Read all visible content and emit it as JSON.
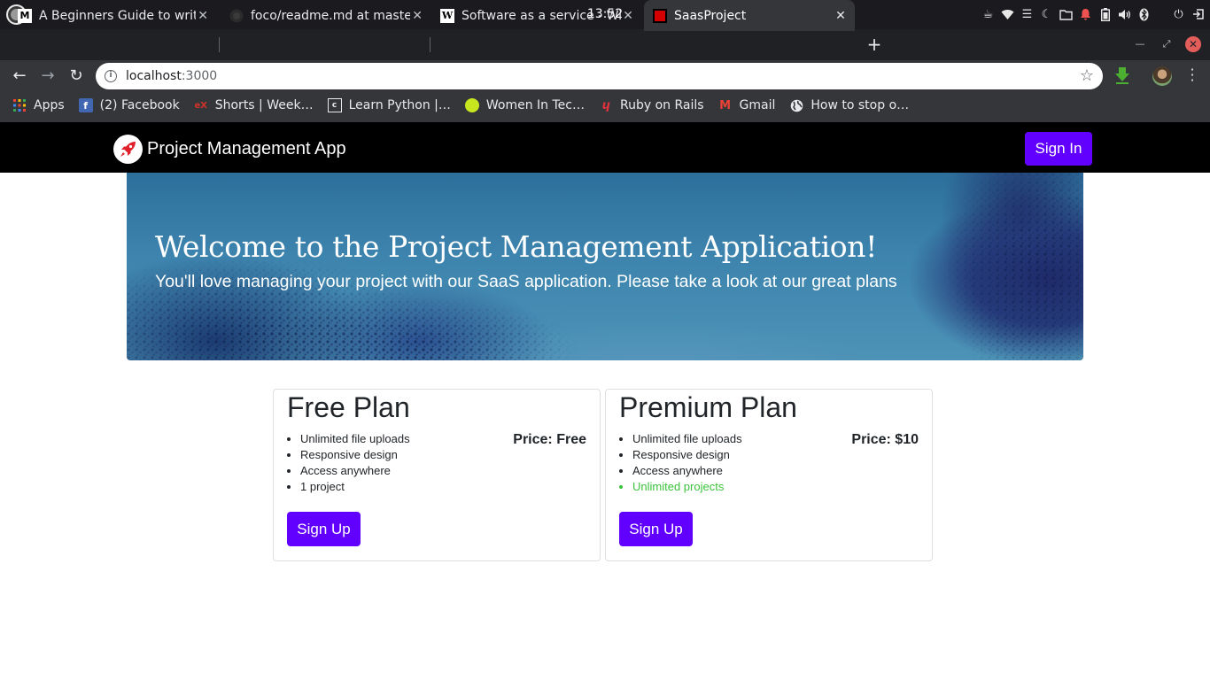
{
  "os": {
    "clock": "13:52",
    "tray_icons": [
      "coffee-icon",
      "wifi-icon",
      "menu-icon",
      "night-mode-icon",
      "folder-icon",
      "notification-icon",
      "battery-icon",
      "volume-icon",
      "bluetooth-icon",
      "power-icon",
      "logout-icon"
    ]
  },
  "tabs": [
    {
      "title": "A Beginners Guide to writ",
      "favicon": "medium-icon",
      "active": false
    },
    {
      "title": "foco/readme.md at maste",
      "favicon": "github-icon",
      "active": false
    },
    {
      "title": "Software as a service - Wi",
      "favicon": "wikipedia-icon",
      "active": false
    },
    {
      "title": "SaasProject",
      "favicon": "saas-icon",
      "active": true
    }
  ],
  "toolbar": {
    "url_host": "localhost",
    "url_port": ":3000"
  },
  "bookmarks": [
    {
      "label": "Apps",
      "icon": "apps-grid-icon"
    },
    {
      "label": "(2) Facebook",
      "icon": "facebook-icon"
    },
    {
      "label": "Shorts | Week…",
      "icon": "edx-icon"
    },
    {
      "label": "Learn Python |…",
      "icon": "codecademy-icon"
    },
    {
      "label": "Women In Tec…",
      "icon": "women-in-tech-icon"
    },
    {
      "label": "Ruby on Rails",
      "icon": "rails-icon"
    },
    {
      "label": "Gmail",
      "icon": "gmail-icon"
    },
    {
      "label": "How to stop o…",
      "icon": "globe-icon"
    }
  ],
  "site": {
    "brand": "Project Management App",
    "signin_label": "Sign In",
    "hero": {
      "title": "Welcome to the Project Management Application!",
      "subtitle": "You'll love managing your project with our SaaS application. Please take a look at our great plans"
    },
    "plans": [
      {
        "name": "Free Plan",
        "price": "Price: Free",
        "features": [
          "Unlimited file uploads",
          "Responsive design",
          "Access anywhere",
          "1 project"
        ],
        "highlight_last": false,
        "button": "Sign Up"
      },
      {
        "name": "Premium Plan",
        "price": "Price: $10",
        "features": [
          "Unlimited file uploads",
          "Responsive design",
          "Access anywhere",
          "Unlimited projects"
        ],
        "highlight_last": true,
        "button": "Sign Up"
      }
    ],
    "accent_color": "#6200ff",
    "highlight_color": "#3cc33c"
  }
}
